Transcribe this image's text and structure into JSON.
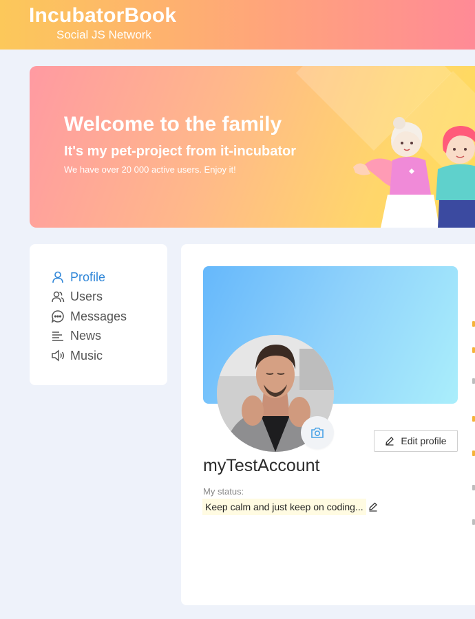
{
  "header": {
    "title": "IncubatorBook",
    "subtitle": "Social JS Network"
  },
  "banner": {
    "title": "Welcome to the family",
    "subtitle": "It's my pet-project from it-incubator",
    "text": "We have over 20 000 active users. Enjoy it!"
  },
  "sidebar": {
    "items": [
      {
        "label": "Profile",
        "icon": "user-icon",
        "active": true
      },
      {
        "label": "Users",
        "icon": "users-icon",
        "active": false
      },
      {
        "label": "Messages",
        "icon": "message-icon",
        "active": false
      },
      {
        "label": "News",
        "icon": "news-icon",
        "active": false
      },
      {
        "label": "Music",
        "icon": "speaker-icon",
        "active": false
      }
    ]
  },
  "profile": {
    "name": "myTestAccount",
    "status_label": "My status:",
    "status": "Keep calm and just keep on coding...",
    "edit_label": "Edit profile"
  },
  "colors": {
    "accent": "#2f86d8",
    "header_start": "#fcc85a",
    "header_end": "#ff8a96",
    "cover_start": "#66b8fb",
    "cover_end": "#aaeefb",
    "status_bg": "#fffbe2",
    "page_bg": "#eef2fa"
  }
}
